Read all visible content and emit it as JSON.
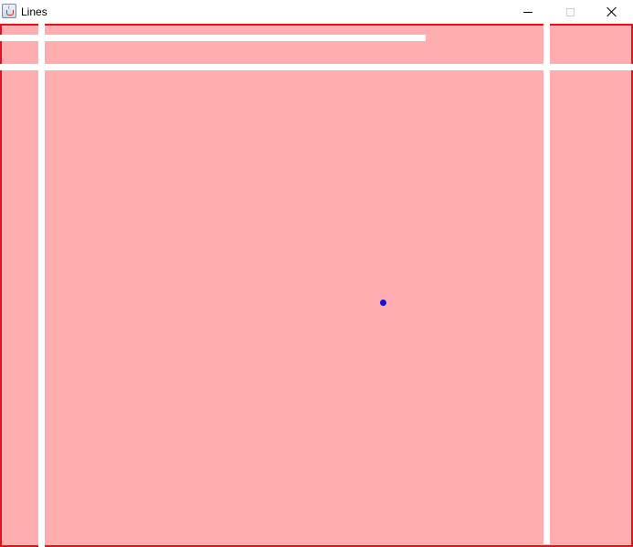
{
  "window": {
    "title": "Lines",
    "icon": "java-cup-icon",
    "controls": [
      "minimize",
      "maximize",
      "close"
    ]
  },
  "canvas": {
    "background_color": "#ffaeb0",
    "border_color": "#e8101a",
    "line_color": "#ffffff",
    "point_color": "#1010d8"
  }
}
